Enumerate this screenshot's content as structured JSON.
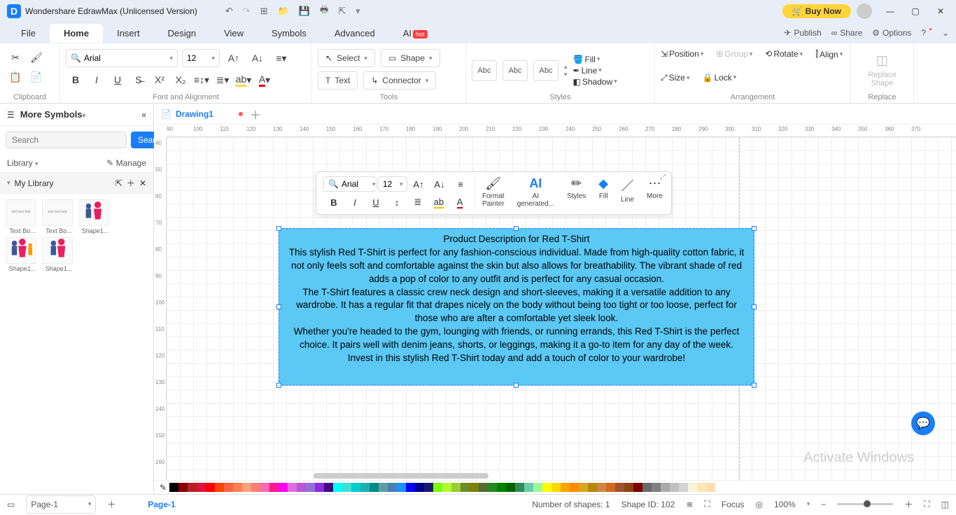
{
  "titlebar": {
    "app_title": "Wondershare EdrawMax (Unlicensed Version)",
    "buy_now": "Buy Now"
  },
  "menubar": {
    "tabs": [
      "File",
      "Home",
      "Insert",
      "Design",
      "View",
      "Symbols",
      "Advanced",
      "AI"
    ],
    "active": 1,
    "hot_badge": "hot",
    "right": {
      "publish": "Publish",
      "share": "Share",
      "options": "Options"
    }
  },
  "ribbon": {
    "clipboard": "Clipboard",
    "font_align": "Font and Alignment",
    "tools": "Tools",
    "styles": "Styles",
    "arrangement": "Arrangement",
    "replace": "Replace",
    "font_name": "Arial",
    "font_size": "12",
    "select": "Select",
    "shape": "Shape",
    "text": "Text",
    "connector": "Connector",
    "abc": "Abc",
    "fill": "Fill",
    "line": "Line",
    "shadow": "Shadow",
    "position": "Position",
    "align": "Align",
    "group": "Group",
    "size": "Size",
    "rotate": "Rotate",
    "lock": "Lock",
    "replace_shape": "Replace\nShape"
  },
  "sidebar": {
    "more_symbols": "More Symbols",
    "search_placeholder": "Search",
    "search_btn": "Search",
    "library": "Library",
    "manage": "Manage",
    "my_library": "My Library",
    "items": [
      {
        "label": "Text Bo..."
      },
      {
        "label": "Text Bo..."
      },
      {
        "label": "Shape1..."
      },
      {
        "label": "Shape1..."
      },
      {
        "label": "Shape1..."
      }
    ]
  },
  "document": {
    "tab_name": "Drawing1"
  },
  "ruler_h": [
    "90",
    "100",
    "110",
    "120",
    "130",
    "140",
    "150",
    "160",
    "170",
    "180",
    "190",
    "200",
    "210",
    "220",
    "230",
    "240",
    "250",
    "260",
    "270",
    "280",
    "290",
    "300",
    "310",
    "320",
    "330",
    "340",
    "350",
    "360",
    "370"
  ],
  "ruler_v": [
    "40",
    "50",
    "60",
    "70",
    "80",
    "90",
    "100",
    "110",
    "120",
    "130",
    "140",
    "150",
    "160"
  ],
  "textbox": {
    "title": "Product Description for Red T-Shirt",
    "p1": "This stylish Red T-Shirt is perfect for any fashion-conscious individual. Made from high-quality cotton fabric, it not only feels soft and comfortable against the skin but also allows for breathability. The vibrant shade of red adds a pop of color to any outfit and is perfect for any casual occasion.",
    "p2": "The T-Shirt features a classic crew neck design and short-sleeves, making it a versatile addition to any wardrobe. It has a regular fit that drapes nicely on the body without being too tight or too loose, perfect for those who are after a comfortable yet sleek look.",
    "p3": "Whether you're headed to the gym, lounging with friends, or running errands, this Red T-Shirt is the perfect choice. It pairs well with denim jeans, shorts, or leggings, making it a go-to item for any day of the week.",
    "p4": "Invest in this stylish Red T-Shirt today and add a touch of color to your wardrobe!"
  },
  "float_toolbar": {
    "font_name": "Arial",
    "font_size": "12",
    "format_painter": "Format\nPainter",
    "ai": "AI\ngenerated...",
    "styles": "Styles",
    "fill": "Fill",
    "line": "Line",
    "more": "More"
  },
  "colorbar": [
    "#000",
    "#8b0000",
    "#b22222",
    "#dc143c",
    "#ff0000",
    "#ff4500",
    "#ff6347",
    "#ff7f50",
    "#ffa07a",
    "#fa8072",
    "#ff69b4",
    "#ff1493",
    "#ff00ff",
    "#da70d6",
    "#ba55d3",
    "#9370db",
    "#8a2be2",
    "#4b0082",
    "#00ffff",
    "#40e0d0",
    "#00ced1",
    "#20b2aa",
    "#008b8b",
    "#5f9ea0",
    "#4682b4",
    "#1e90ff",
    "#0000ff",
    "#00008b",
    "#191970",
    "#7cfc00",
    "#adff2f",
    "#9acd32",
    "#6b8e23",
    "#808000",
    "#556b2f",
    "#228b22",
    "#008000",
    "#006400",
    "#2e8b57",
    "#66cdaa",
    "#98fb98",
    "#ffff00",
    "#ffd700",
    "#ffa500",
    "#ff8c00",
    "#daa520",
    "#b8860b",
    "#cd853f",
    "#d2691e",
    "#a0522d",
    "#8b4513",
    "#800000",
    "#696969",
    "#808080",
    "#a9a9a9",
    "#c0c0c0",
    "#d3d3d3",
    "#f5f5dc",
    "#ffe4b5",
    "#ffdead"
  ],
  "statusbar": {
    "page": "Page-1",
    "page_tab": "Page-1",
    "shapes": "Number of shapes: 1",
    "shape_id": "Shape ID: 102",
    "focus": "Focus",
    "zoom": "100%"
  },
  "watermark": "Activate Windows"
}
